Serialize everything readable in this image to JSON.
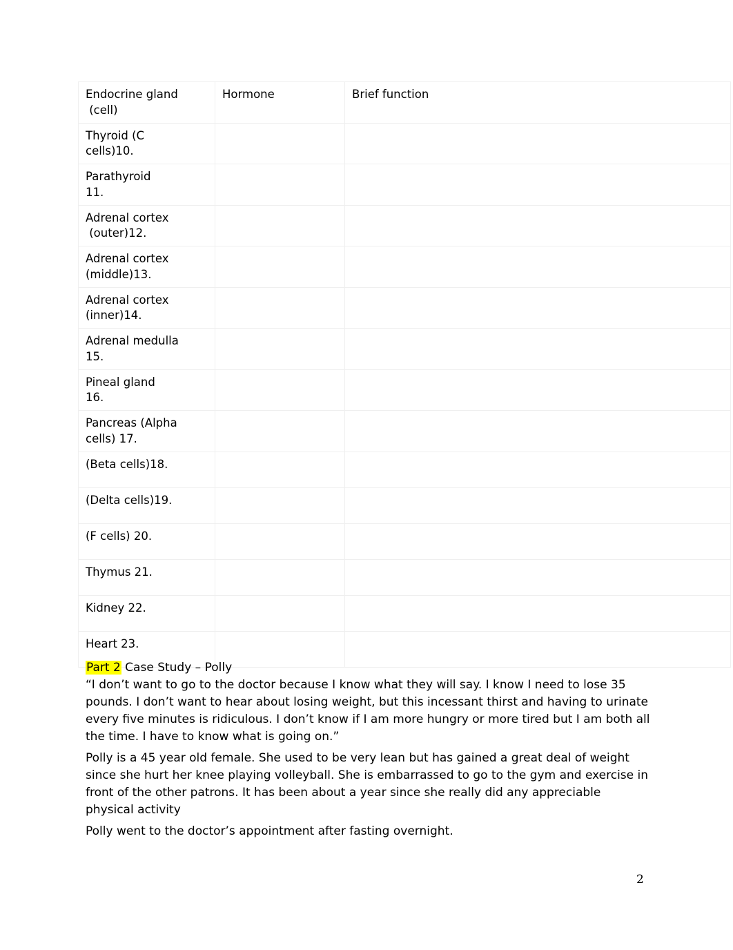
{
  "document": {
    "page_number": "2",
    "highlight_color": "#ffff00",
    "text_color": "#000000",
    "table_border_color": "#efefef"
  },
  "table": {
    "headers": {
      "gland": "Endocrine gland\n (cell)",
      "hormone": "Hormone",
      "function": "Brief function"
    },
    "rows": [
      {
        "gland": "Thyroid (C\ncells)10.",
        "hormone": "",
        "function": ""
      },
      {
        "gland": "Parathyroid\n11.",
        "hormone": "",
        "function": ""
      },
      {
        "gland": "Adrenal cortex\n (outer)12.",
        "hormone": "",
        "function": ""
      },
      {
        "gland": "Adrenal cortex\n(middle)13.",
        "hormone": "",
        "function": ""
      },
      {
        "gland": "Adrenal cortex\n(inner)14.",
        "hormone": "",
        "function": ""
      },
      {
        "gland": "Adrenal medulla\n15.",
        "hormone": "",
        "function": ""
      },
      {
        "gland": "Pineal gland\n16.",
        "hormone": "",
        "function": ""
      },
      {
        "gland": "Pancreas (Alpha\ncells) 17.",
        "hormone": "",
        "function": ""
      },
      {
        "gland": "(Beta cells)18.",
        "hormone": "",
        "function": ""
      },
      {
        "gland": "(Delta cells)19.",
        "hormone": "",
        "function": ""
      },
      {
        "gland": "(F cells) 20.",
        "hormone": "",
        "function": ""
      },
      {
        "gland": "Thymus 21.",
        "hormone": "",
        "function": ""
      },
      {
        "gland": "Kidney 22.",
        "hormone": "",
        "function": ""
      },
      {
        "gland": "Heart 23.",
        "hormone": "",
        "function": ""
      }
    ]
  },
  "part2": {
    "label": "Part 2",
    "title_rest": " Case Study – Polly",
    "quote": "“I don’t want to go to the doctor because I know what they will say.  I know I need to lose 35 pounds. I don’t want to hear about losing weight, but this incessant thirst and having to urinate every five minutes is ridiculous. I don’t know if I am more hungry or more tired but I am both all the time. I have to know what is going on.”",
    "paragraph_polly": "Polly is a 45 year old female. She used to be very lean but has gained a great deal of weight since she hurt her knee playing volleyball. She is embarrassed to go to the gym and exercise in front of the other patrons. It has been about a year since she really did any appreciable physical activity",
    "paragraph_fasting": "Polly went to the doctor’s appointment after fasting overnight."
  }
}
